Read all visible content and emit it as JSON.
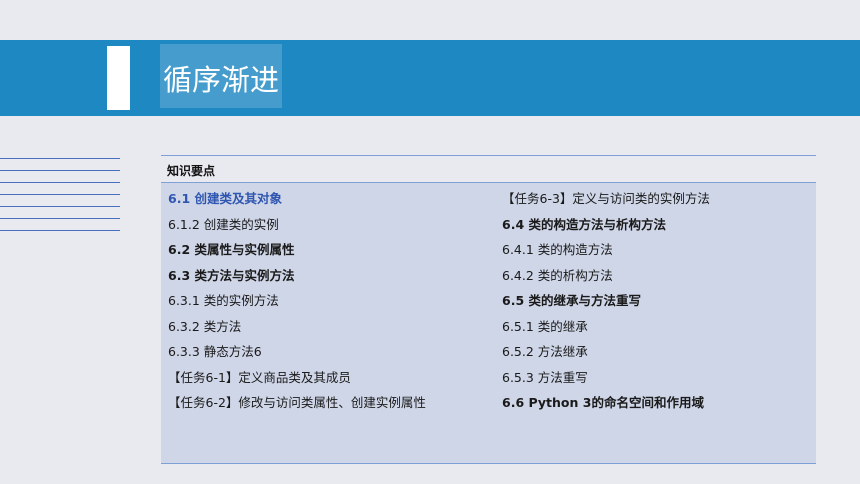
{
  "banner": {
    "title": "循序渐进"
  },
  "panel": {
    "header": "知识要点",
    "left_items": [
      {
        "text": "6.1 创建类及其对象",
        "style": "accent"
      },
      {
        "text": "6.1.2 创建类的实例",
        "style": "normal"
      },
      {
        "text": "6.2 类属性与实例属性",
        "style": "bold"
      },
      {
        "text": "6.3 类方法与实例方法",
        "style": "bold"
      },
      {
        "text": "6.3.1 类的实例方法",
        "style": "normal"
      },
      {
        "text": "6.3.2 类方法",
        "style": "normal"
      },
      {
        "text": "6.3.3 静态方法6",
        "style": "normal"
      },
      {
        "text": "【任务6-1】定义商品类及其成员",
        "style": "normal"
      },
      {
        "text": "【任务6-2】修改与访问类属性、创建实例属性",
        "style": "normal"
      }
    ],
    "right_items": [
      {
        "text": "【任务6-3】定义与访问类的实例方法",
        "style": "normal"
      },
      {
        "text": "6.4 类的构造方法与析构方法",
        "style": "bold"
      },
      {
        "text": "6.4.1 类的构造方法",
        "style": "normal"
      },
      {
        "text": "6.4.2 类的析构方法",
        "style": "normal"
      },
      {
        "text": "6.5 类的继承与方法重写",
        "style": "bold"
      },
      {
        "text": "6.5.1 类的继承",
        "style": "normal"
      },
      {
        "text": "6.5.2 方法继承",
        "style": "normal"
      },
      {
        "text": "6.5.3 方法重写",
        "style": "normal"
      },
      {
        "text": "6.6 Python 3的命名空间和作用域",
        "style": "bold"
      }
    ]
  },
  "colors": {
    "banner": "#1e88c2",
    "accent_text": "#2f56b0",
    "panel_body": "#cfd6e8",
    "rule": "#7fa0d6"
  }
}
